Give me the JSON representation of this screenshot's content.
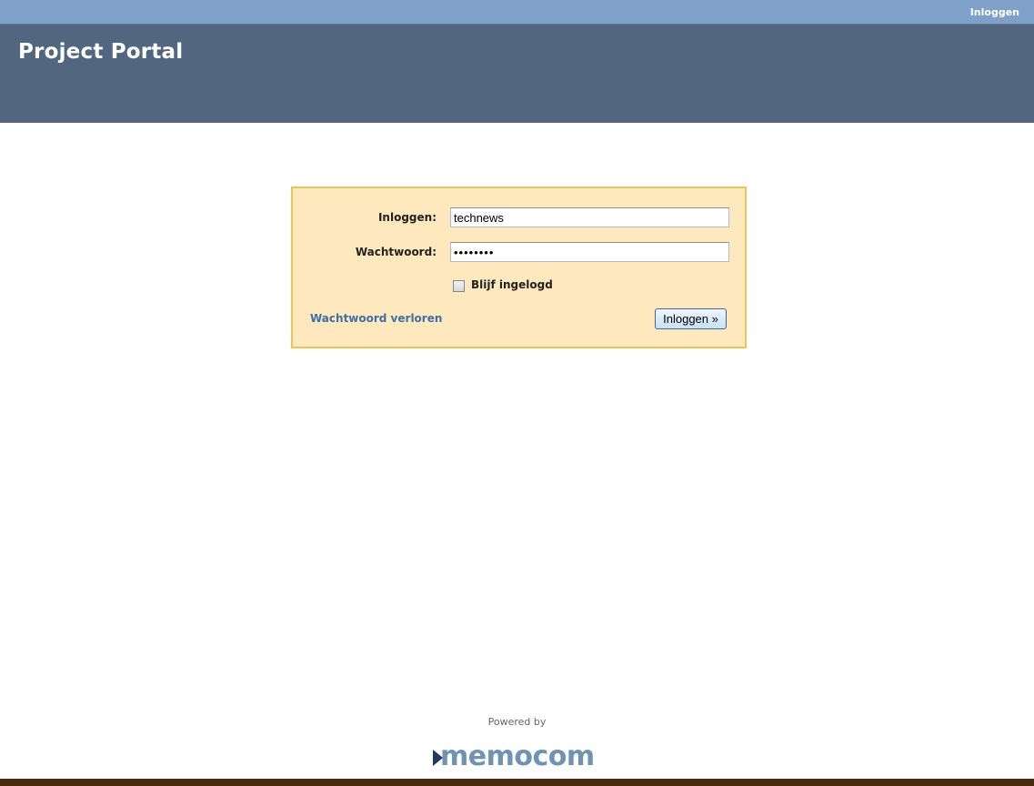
{
  "topbar": {
    "login_link": "Inloggen"
  },
  "header": {
    "title": "Project Portal"
  },
  "login_form": {
    "username_label": "Inloggen:",
    "username_value": "technews",
    "password_label": "Wachtwoord:",
    "password_value": "••••••••",
    "remember_label": "Blijf ingelogd",
    "remember_checked": false,
    "lost_password_link": "Wachtwoord verloren",
    "submit_label": "Inloggen »"
  },
  "footer": {
    "powered_by": "Powered by",
    "logo_text": "memocom"
  },
  "colors": {
    "topbar": "#7fa1c9",
    "header": "#52677f",
    "form_background": "#fde9bd",
    "form_border": "#eec553",
    "link": "#3d6fa8",
    "footer_bar": "#4a2b0f"
  }
}
